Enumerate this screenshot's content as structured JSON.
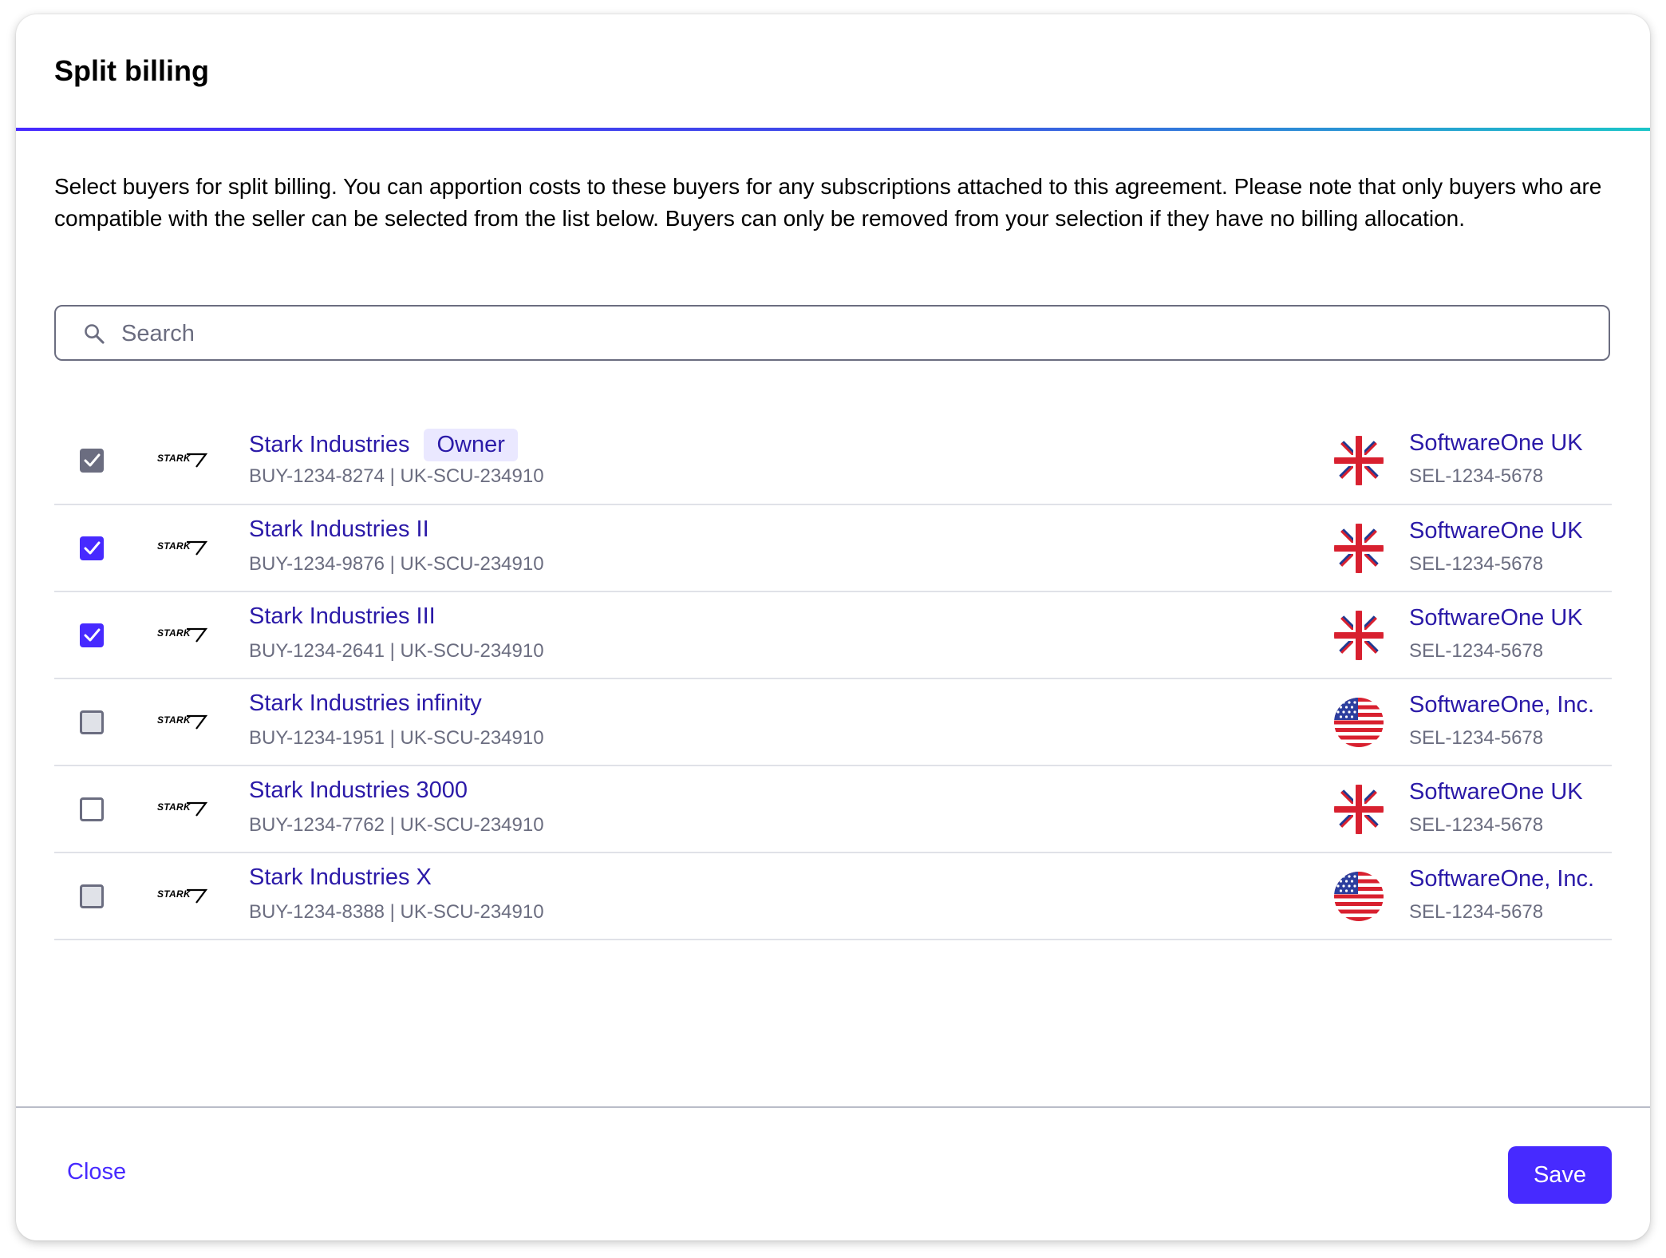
{
  "dialog": {
    "title": "Split billing",
    "description": "Select buyers for split billing. You can apportion costs to these buyers for any subscriptions attached to this agreement. Please note that only buyers who are compatible with the seller can be selected from the list below. Buyers can only be removed from your selection if they have no billing allocation."
  },
  "search": {
    "placeholder": "Search",
    "value": "",
    "icon": "search-icon"
  },
  "buyers": [
    {
      "name": "Stark Industries",
      "badge": "Owner",
      "sub": "BUY-1234-8274 | UK-SCU-234910",
      "checkbox": "checked-disabled",
      "logo": "STARK",
      "seller_flag": "uk-flag-icon",
      "seller_name": "SoftwareOne UK",
      "seller_id": "SEL-1234-5678"
    },
    {
      "name": "Stark Industries II",
      "sub": "BUY-1234-9876 | UK-SCU-234910",
      "checkbox": "checked",
      "logo": "STARK",
      "seller_flag": "uk-flag-icon",
      "seller_name": "SoftwareOne UK",
      "seller_id": "SEL-1234-5678"
    },
    {
      "name": "Stark Industries III",
      "sub": "BUY-1234-2641 | UK-SCU-234910",
      "checkbox": "checked",
      "logo": "STARK",
      "seller_flag": "uk-flag-icon",
      "seller_name": "SoftwareOne UK",
      "seller_id": "SEL-1234-5678"
    },
    {
      "name": "Stark Industries infinity",
      "sub": "BUY-1234-1951 | UK-SCU-234910",
      "checkbox": "unchecked-disabled",
      "logo": "STARK",
      "seller_flag": "us-flag-icon",
      "seller_name": "SoftwareOne, Inc.",
      "seller_id": "SEL-1234-5678"
    },
    {
      "name": "Stark Industries 3000",
      "sub": "BUY-1234-7762 | UK-SCU-234910",
      "checkbox": "unchecked",
      "logo": "STARK",
      "seller_flag": "uk-flag-icon",
      "seller_name": "SoftwareOne UK",
      "seller_id": "SEL-1234-5678"
    },
    {
      "name": "Stark Industries X",
      "sub": "BUY-1234-8388 | UK-SCU-234910",
      "checkbox": "unchecked-disabled",
      "logo": "STARK",
      "seller_flag": "us-flag-icon",
      "seller_name": "SoftwareOne, Inc.",
      "seller_id": "SEL-1234-5678"
    }
  ],
  "footer": {
    "close_label": "Close",
    "save_label": "Save"
  },
  "colors": {
    "accent": "#472aff",
    "link": "#2b1aa8",
    "muted": "#6b6d80",
    "divider": "#e0e2e8"
  }
}
